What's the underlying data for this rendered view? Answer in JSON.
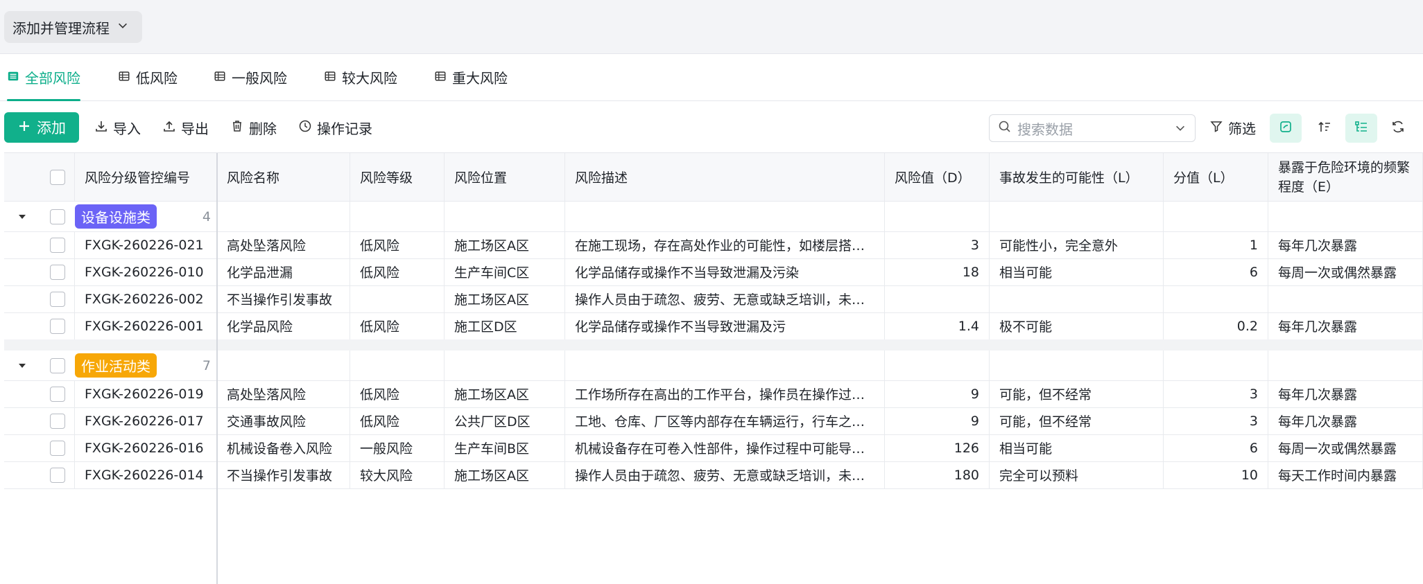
{
  "process_menu": {
    "label": "添加并管理流程"
  },
  "tabs": [
    {
      "label": "全部风险",
      "active": true
    },
    {
      "label": "低风险"
    },
    {
      "label": "一般风险"
    },
    {
      "label": "较大风险"
    },
    {
      "label": "重大风险"
    }
  ],
  "toolbar": {
    "add": "添加",
    "import": "导入",
    "export": "导出",
    "delete": "删除",
    "history": "操作记录",
    "filter": "筛选",
    "search_placeholder": "搜索数据"
  },
  "columns": [
    "风险分级管控编号",
    "风险名称",
    "风险等级",
    "风险位置",
    "风险描述",
    "风险值（D）",
    "事故发生的可能性（L）",
    "分值（L）",
    "暴露于危险环境的频繁程度（E）"
  ],
  "groups": [
    {
      "name": "设备设施类",
      "count": "4",
      "color": "#6b63f6",
      "rows": [
        [
          "FXGK-260226-021",
          "高处坠落风险",
          "低风险",
          "施工场区A区",
          "在施工现场，存在高处作业的可能性，如楼层搭设、外墙装修等",
          "3",
          "可能性小，完全意外",
          "1",
          "每年几次暴露"
        ],
        [
          "FXGK-260226-010",
          "化学品泄漏",
          "低风险",
          "生产车间C区",
          "化学品储存或操作不当导致泄漏及污染",
          "18",
          "相当可能",
          "6",
          "每周一次或偶然暴露"
        ],
        [
          "FXGK-260226-002",
          "不当操作引发事故",
          "",
          "施工场区A区",
          "操作人员由于疏忽、疲劳、无意或缺乏培训，未按规程操作",
          "",
          "",
          "",
          ""
        ],
        [
          "FXGK-260226-001",
          "化学品风险",
          "低风险",
          "施工区D区",
          "化学品储存或操作不当导致泄漏及污",
          "1.4",
          "极不可能",
          "0.2",
          "每年几次暴露"
        ]
      ]
    },
    {
      "name": "作业活动类",
      "count": "7",
      "color": "#f7a707",
      "rows": [
        [
          "FXGK-260226-019",
          "高处坠落风险",
          "低风险",
          "施工场区A区",
          "工作场所存在高出的工作平台，操作员在操作过程中可能坠落",
          "9",
          "可能，但不经常",
          "3",
          "每年几次暴露"
        ],
        [
          "FXGK-260226-017",
          "交通事故风险",
          "低风险",
          "公共厂区D区",
          "工地、仓库、厂区等内部存在车辆运行，行车之间可能发生碰撞",
          "9",
          "可能，但不经常",
          "3",
          "每年几次暴露"
        ],
        [
          "FXGK-260226-016",
          "机械设备卷入风险",
          "一般风险",
          "生产车间B区",
          "机械设备存在可卷入性部件，操作过程中可能导致人员卷入",
          "126",
          "相当可能",
          "6",
          "每周一次或偶然暴露"
        ],
        [
          "FXGK-260226-014",
          "不当操作引发事故",
          "较大风险",
          "施工场区A区",
          "操作人员由于疏忽、疲劳、无意或缺乏培训，未按规程操作",
          "180",
          "完全可以预料",
          "10",
          "每天工作时间内暴露"
        ]
      ]
    }
  ],
  "colors": {
    "accent": "#11b08b",
    "tab_active": "#0cae8a"
  }
}
